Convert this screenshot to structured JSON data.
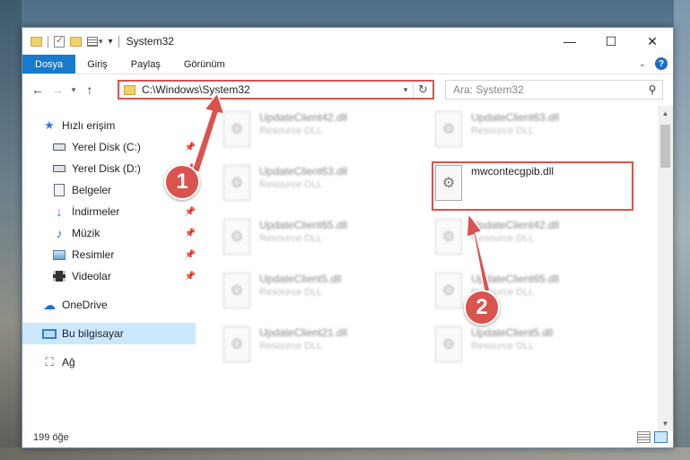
{
  "window": {
    "title": "System32",
    "controls": {
      "minimize": "—",
      "maximize": "☐",
      "close": "✕"
    }
  },
  "ribbon": {
    "tabs": [
      "Dosya",
      "Giriş",
      "Paylaş",
      "Görünüm"
    ]
  },
  "nav": {
    "address": "C:\\Windows\\System32",
    "search_placeholder": "Ara: System32"
  },
  "sidebar": {
    "items": [
      {
        "label": "Hızlı erişim",
        "icon": "star-icon"
      },
      {
        "label": "Yerel Disk (C:)",
        "icon": "drive-icon",
        "pinned": true
      },
      {
        "label": "Yerel Disk (D:)",
        "icon": "drive-icon",
        "pinned": true
      },
      {
        "label": "Belgeler",
        "icon": "document-icon",
        "pinned": true
      },
      {
        "label": "İndirmeler",
        "icon": "download-icon",
        "pinned": true
      },
      {
        "label": "Müzik",
        "icon": "music-icon",
        "pinned": true
      },
      {
        "label": "Resimler",
        "icon": "pictures-icon",
        "pinned": true
      },
      {
        "label": "Videolar",
        "icon": "video-icon",
        "pinned": true
      },
      {
        "label": "OneDrive",
        "icon": "cloud-icon"
      },
      {
        "label": "Bu bilgisayar",
        "icon": "computer-icon",
        "selected": true
      },
      {
        "label": "Ağ",
        "icon": "network-icon"
      }
    ]
  },
  "files": [
    {
      "name": "UpdateClient42.dll",
      "type": "Resource DLL",
      "blurred": true
    },
    {
      "name": "UpdateClient63.dll",
      "type": "Resource DLL",
      "blurred": true
    },
    {
      "name": "UpdateClient63.dll",
      "type": "Resource DLL",
      "blurred": true
    },
    {
      "name": "mwcontecgpib.dll",
      "type": "",
      "blurred": false
    },
    {
      "name": "UpdateClient65.dll",
      "type": "Resource DLL",
      "blurred": true
    },
    {
      "name": "UpdateClient42.dll",
      "type": "Resource DLL",
      "blurred": true
    },
    {
      "name": "UpdateClient5.dll",
      "type": "Resource DLL",
      "blurred": true
    },
    {
      "name": "UpdateClient65.dll",
      "type": "Resource DLL",
      "blurred": true
    },
    {
      "name": "UpdateClient21.dll",
      "type": "Resource DLL",
      "blurred": true
    },
    {
      "name": "UpdateClient5.dll",
      "type": "Resource DLL",
      "blurred": true
    }
  ],
  "status": {
    "count": "199 öğe"
  },
  "annotations": {
    "step1": "1",
    "step2": "2",
    "color": "#d9534f"
  }
}
